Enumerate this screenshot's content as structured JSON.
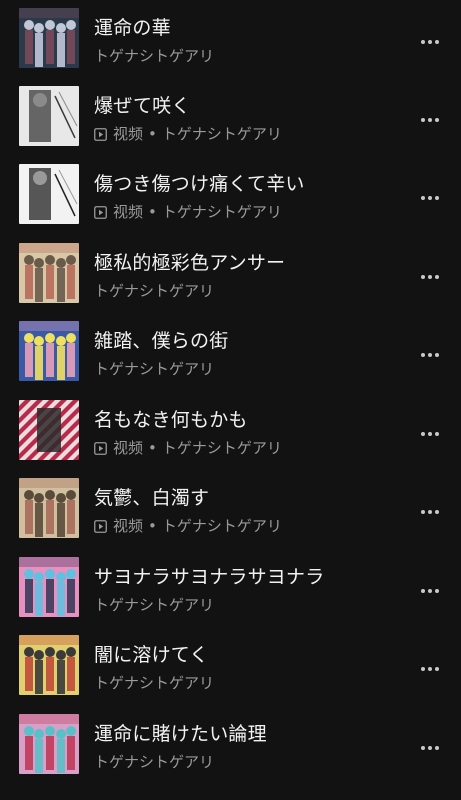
{
  "songs": [
    {
      "title": "運命の華",
      "has_video": false,
      "video_label": "",
      "separator": "",
      "artist": "トゲナシトゲアリ",
      "art": {
        "bg": "#2a3a4a",
        "accent": "#c0c8d8",
        "accent2": "#7a4a5a",
        "style": "band-dark"
      }
    },
    {
      "title": "爆ぜて咲く",
      "has_video": true,
      "video_label": "视频",
      "separator": "•",
      "artist": "トゲナシトゲアリ",
      "art": {
        "bg": "#e8e8e8",
        "accent": "#3a3a3a",
        "accent2": "#8a8a8a",
        "style": "sketch"
      }
    },
    {
      "title": "傷つき傷つけ痛くて辛い",
      "has_video": true,
      "video_label": "视频",
      "separator": "•",
      "artist": "トゲナシトゲアリ",
      "art": {
        "bg": "#f2f2f2",
        "accent": "#222222",
        "accent2": "#9a9a9a",
        "style": "ink"
      }
    },
    {
      "title": "極私的極彩色アンサー",
      "has_video": false,
      "video_label": "",
      "separator": "",
      "artist": "トゲナシトゲアリ",
      "art": {
        "bg": "#d8c8a8",
        "accent": "#6a5a4a",
        "accent2": "#b86a5a",
        "style": "warm"
      }
    },
    {
      "title": "雑踏、僕らの街",
      "has_video": false,
      "video_label": "",
      "separator": "",
      "artist": "トゲナシトゲアリ",
      "art": {
        "bg": "#3a5aa8",
        "accent": "#f0e060",
        "accent2": "#e8a0b8",
        "style": "bright"
      }
    },
    {
      "title": "名もなき何もかも",
      "has_video": true,
      "video_label": "视频",
      "separator": "•",
      "artist": "トゲナシトゲアリ",
      "art": {
        "bg": "#b82a4a",
        "accent": "#f0f0f0",
        "accent2": "#2a2a2a",
        "style": "stripes"
      }
    },
    {
      "title": "気鬱、白濁す",
      "has_video": true,
      "video_label": "视频",
      "separator": "•",
      "artist": "トゲナシトゲアリ",
      "art": {
        "bg": "#d0c0a0",
        "accent": "#5a4a3a",
        "accent2": "#a86a5a",
        "style": "warm"
      }
    },
    {
      "title": "サヨナラサヨナラサヨナラ",
      "has_video": false,
      "video_label": "",
      "separator": "",
      "artist": "トゲナシトゲアリ",
      "art": {
        "bg": "#e890c0",
        "accent": "#60c0e0",
        "accent2": "#3a3a5a",
        "style": "pop"
      }
    },
    {
      "title": "闇に溶けてく",
      "has_video": false,
      "video_label": "",
      "separator": "",
      "artist": "トゲナシトゲアリ",
      "art": {
        "bg": "#e0d070",
        "accent": "#3a3a3a",
        "accent2": "#c04a3a",
        "style": "yellow"
      }
    },
    {
      "title": "運命に賭けたい論理",
      "has_video": false,
      "video_label": "",
      "separator": "",
      "artist": "トゲナシトゲアリ",
      "art": {
        "bg": "#d8a0c8",
        "accent": "#5ac0c8",
        "accent2": "#c03a5a",
        "style": "pop"
      }
    }
  ]
}
